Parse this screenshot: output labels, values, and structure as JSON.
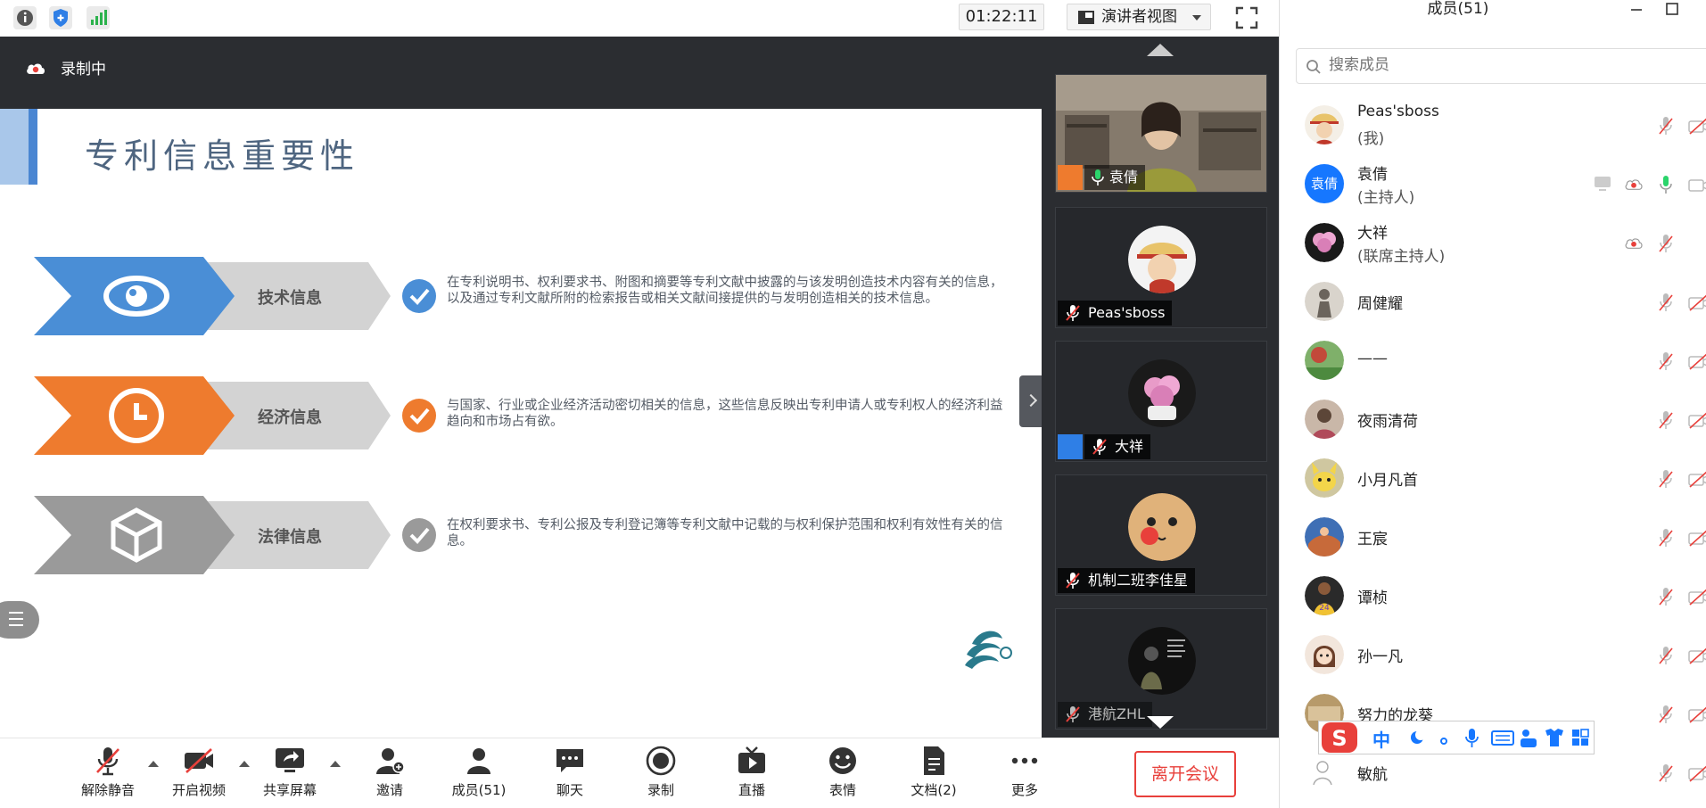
{
  "topbar": {
    "timer": "01:22:11",
    "view_label": "演讲者视图",
    "icons": [
      "info-icon",
      "shield-icon",
      "signal-icon",
      "fullscreen-icon"
    ]
  },
  "recording": {
    "label": "录制中"
  },
  "slide": {
    "title": "专利信息重要性",
    "rows": [
      {
        "tag": "技术信息",
        "icon": "eye-icon",
        "color": "#4a8ed6",
        "desc": "在专利说明书、权利要求书、附图和摘要等专利文献中披露的与该发明创造技术内容有关的信息，以及通过专利文献所附的检索报告或相关文献间接提供的与发明创造相关的技术信息。"
      },
      {
        "tag": "经济信息",
        "icon": "clock-icon",
        "color": "#ee7b2e",
        "desc": "与国家、行业或企业经济活动密切相关的信息，这些信息反映出专利申请人或专利权人的经济利益趋向和市场占有欲。"
      },
      {
        "tag": "法律信息",
        "icon": "cube-icon",
        "color": "#9a9a9a",
        "desc": "在权利要求书、专利公报及专利登记簿等专利文献中记载的与权利保护范围和权利有效性有关的信息。"
      }
    ]
  },
  "videos": [
    {
      "name": "袁倩"
    },
    {
      "name": "Peas'sboss"
    },
    {
      "name": "大祥"
    },
    {
      "name": "机制二班李佳星"
    },
    {
      "name": "港航ZHL"
    }
  ],
  "toolbar": {
    "buttons": [
      {
        "label": "解除静音",
        "icon": "mic-muted-icon"
      },
      {
        "label": "开启视频",
        "icon": "camera-off-icon"
      },
      {
        "label": "共享屏幕",
        "icon": "share-screen-icon"
      },
      {
        "label": "邀请",
        "icon": "invite-icon"
      },
      {
        "label": "成员(51)",
        "icon": "members-icon"
      },
      {
        "label": "聊天",
        "icon": "chat-icon"
      },
      {
        "label": "录制",
        "icon": "record-icon"
      },
      {
        "label": "直播",
        "icon": "live-icon"
      },
      {
        "label": "表情",
        "icon": "emoji-icon"
      },
      {
        "label": "文档(2)",
        "icon": "document-icon"
      },
      {
        "label": "更多",
        "icon": "more-icon"
      }
    ],
    "leave": "离开会议"
  },
  "members": {
    "title": "成员(51)",
    "search_placeholder": "搜索成员",
    "list": [
      {
        "name": "Peas'sboss",
        "role": "(我)"
      },
      {
        "name": "袁倩",
        "role": "(主持人)",
        "avatar_text": "袁倩"
      },
      {
        "name": "大祥",
        "role": "(联席主持人)"
      },
      {
        "name": "周健耀",
        "role": ""
      },
      {
        "name": "——",
        "role": ""
      },
      {
        "name": "夜雨清荷",
        "role": ""
      },
      {
        "name": "小月凡首",
        "role": ""
      },
      {
        "name": "王宸",
        "role": ""
      },
      {
        "name": "谭桢",
        "role": ""
      },
      {
        "name": "孙一凡",
        "role": ""
      },
      {
        "name": "努力的龙葵",
        "role": ""
      },
      {
        "name": "敏航",
        "role": ""
      }
    ]
  },
  "ime": {
    "mode": "中"
  }
}
